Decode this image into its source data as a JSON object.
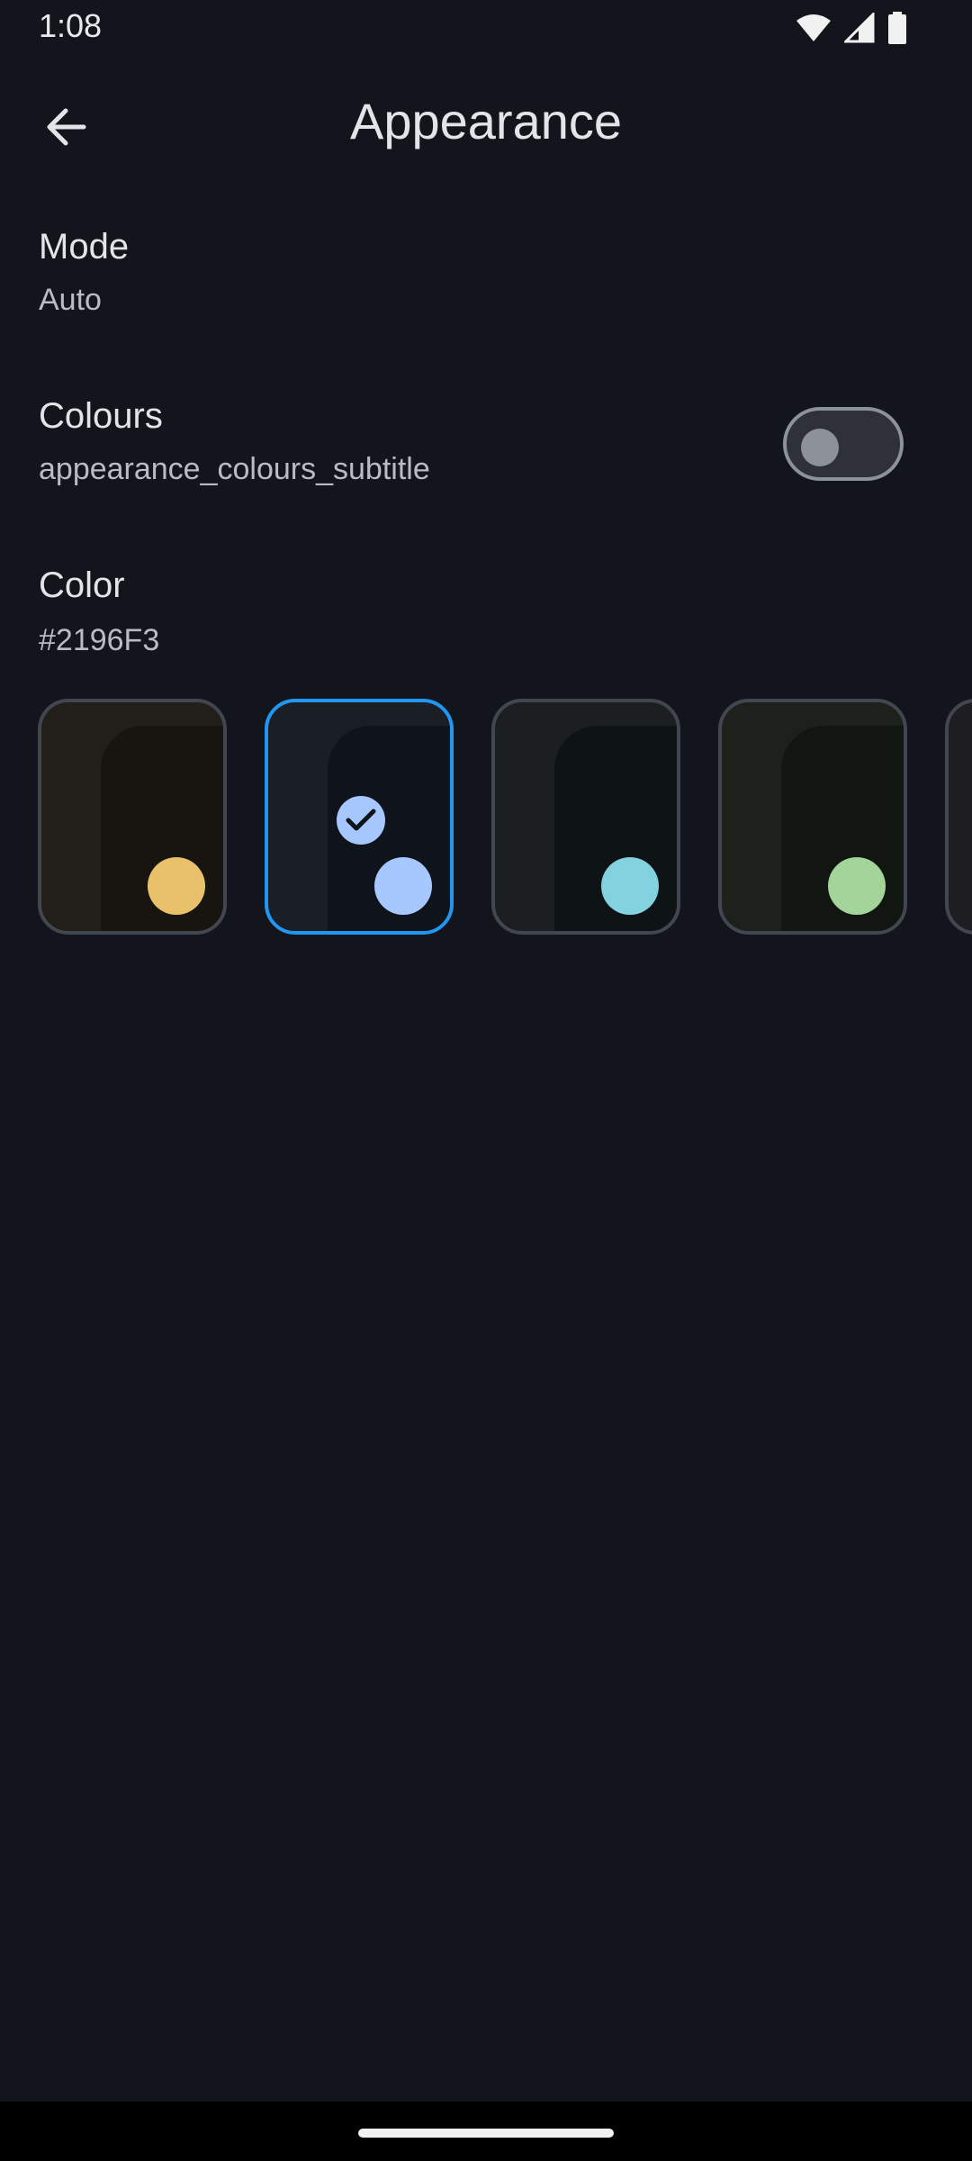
{
  "status_bar": {
    "time": "1:08",
    "icons": [
      "wifi-icon",
      "signal-icon",
      "battery-icon"
    ]
  },
  "app_bar": {
    "title": "Appearance",
    "back_icon": "arrow-back-icon"
  },
  "settings": {
    "mode": {
      "title": "Mode",
      "subtitle": "Auto"
    },
    "colours": {
      "title": "Colours",
      "subtitle": "appearance_colours_subtitle",
      "enabled": false
    },
    "color": {
      "title": "Color",
      "subtitle": "#2196F3"
    }
  },
  "swatches": [
    {
      "outer": "#221e19",
      "inner": "#18140f",
      "dot": "#e8c16a",
      "selected": false
    },
    {
      "outer": "#1a1e25",
      "inner": "#0f131a",
      "dot": "#a6c8ff",
      "selected": true
    },
    {
      "outer": "#1b1f22",
      "inner": "#0e1315",
      "dot": "#82d2e0",
      "selected": false
    },
    {
      "outer": "#1c211c",
      "inner": "#111611",
      "dot": "#a3d59a",
      "selected": false
    },
    {
      "outer": "#1d1d22",
      "inner": "#121217",
      "dot": "#c9c2ff",
      "selected": false
    }
  ],
  "colors": {
    "background": "#12151b",
    "accent": "#2196F3",
    "toggle_outline": "#8d9199"
  }
}
